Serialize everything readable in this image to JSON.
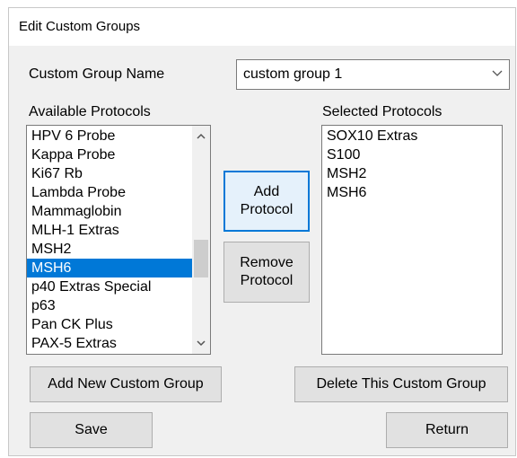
{
  "window": {
    "title": "Edit Custom Groups"
  },
  "group_name": {
    "label": "Custom Group Name",
    "value": "custom group 1"
  },
  "available": {
    "label": "Available Protocols",
    "items": [
      "HPV 6 Probe",
      "Kappa Probe",
      "Ki67 Rb",
      "Lambda Probe",
      "Mammaglobin",
      "MLH-1 Extras",
      "MSH2",
      "MSH6",
      "p40 Extras Special",
      "p63",
      "Pan CK Plus",
      "PAX-5 Extras"
    ],
    "selected": "MSH6"
  },
  "selected": {
    "label": "Selected Protocols",
    "items": [
      "SOX10 Extras",
      "S100",
      "MSH2",
      "MSH6"
    ]
  },
  "buttons": {
    "add_protocol": "Add\nProtocol",
    "remove_protocol": "Remove\nProtocol",
    "add_group": "Add New Custom Group",
    "delete_group": "Delete This Custom Group",
    "save": "Save",
    "return": "Return"
  },
  "icons": {
    "combo_arrow": "chevron-down-icon",
    "scroll_up": "chevron-up-icon",
    "scroll_down": "chevron-down-icon"
  },
  "colors": {
    "selection": "#0078d7",
    "active_button_bg": "#e5f1fb",
    "button_bg": "#e1e1e1"
  }
}
